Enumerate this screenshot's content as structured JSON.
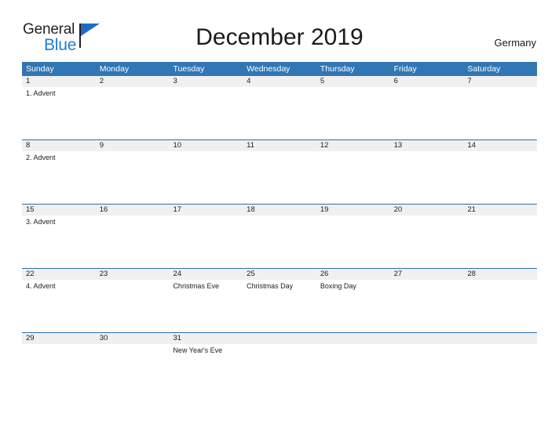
{
  "brand": {
    "word1": "General",
    "word2": "Blue",
    "word1_color": "#231f20",
    "word2_color": "#1a7fd4",
    "flag_color": "#1a6fc4"
  },
  "header": {
    "title": "December 2019",
    "country": "Germany"
  },
  "theme": {
    "header_blue": "#3176b5",
    "date_band_gray": "#f0f0f0",
    "separator_blue": "#2f6fa8",
    "text_dark": "#1c1c1c"
  },
  "calendar": {
    "weekday_headers": [
      "Sunday",
      "Monday",
      "Tuesday",
      "Wednesday",
      "Thursday",
      "Friday",
      "Saturday"
    ],
    "weeks": [
      {
        "days": [
          {
            "date": "1",
            "events": [
              "1. Advent"
            ]
          },
          {
            "date": "2",
            "events": []
          },
          {
            "date": "3",
            "events": []
          },
          {
            "date": "4",
            "events": []
          },
          {
            "date": "5",
            "events": []
          },
          {
            "date": "6",
            "events": []
          },
          {
            "date": "7",
            "events": []
          }
        ]
      },
      {
        "days": [
          {
            "date": "8",
            "events": [
              "2. Advent"
            ]
          },
          {
            "date": "9",
            "events": []
          },
          {
            "date": "10",
            "events": []
          },
          {
            "date": "11",
            "events": []
          },
          {
            "date": "12",
            "events": []
          },
          {
            "date": "13",
            "events": []
          },
          {
            "date": "14",
            "events": []
          }
        ]
      },
      {
        "days": [
          {
            "date": "15",
            "events": [
              "3. Advent"
            ]
          },
          {
            "date": "16",
            "events": []
          },
          {
            "date": "17",
            "events": []
          },
          {
            "date": "18",
            "events": []
          },
          {
            "date": "19",
            "events": []
          },
          {
            "date": "20",
            "events": []
          },
          {
            "date": "21",
            "events": []
          }
        ]
      },
      {
        "days": [
          {
            "date": "22",
            "events": [
              "4. Advent"
            ]
          },
          {
            "date": "23",
            "events": []
          },
          {
            "date": "24",
            "events": [
              "Christmas Eve"
            ]
          },
          {
            "date": "25",
            "events": [
              "Christmas Day"
            ]
          },
          {
            "date": "26",
            "events": [
              "Boxing Day"
            ]
          },
          {
            "date": "27",
            "events": []
          },
          {
            "date": "28",
            "events": []
          }
        ]
      },
      {
        "days": [
          {
            "date": "29",
            "events": []
          },
          {
            "date": "30",
            "events": []
          },
          {
            "date": "31",
            "events": [
              "New Year's Eve"
            ]
          },
          {
            "date": "",
            "events": []
          },
          {
            "date": "",
            "events": []
          },
          {
            "date": "",
            "events": []
          },
          {
            "date": "",
            "events": []
          }
        ]
      }
    ]
  }
}
